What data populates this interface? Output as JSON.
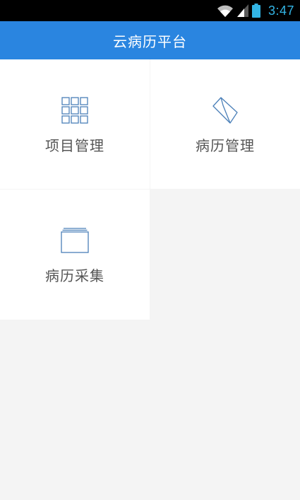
{
  "status_bar": {
    "time": "3:47",
    "icons": [
      "wifi-icon",
      "signal-icon",
      "battery-icon"
    ],
    "clock_color": "#33b5e5"
  },
  "app_bar": {
    "title": "云病历平台",
    "color": "#2a85e0"
  },
  "menu": {
    "items": [
      {
        "label": "项目管理",
        "icon": "grid-icon"
      },
      {
        "label": "病历管理",
        "icon": "folder-icon"
      },
      {
        "label": "病历采集",
        "icon": "card-stack-icon"
      }
    ],
    "icon_color": "#4a7fb8"
  }
}
